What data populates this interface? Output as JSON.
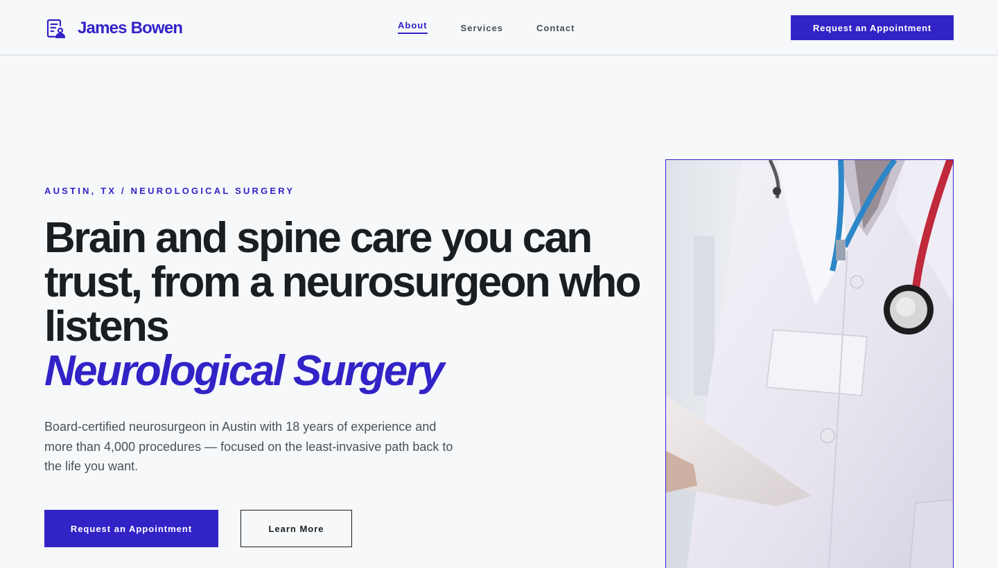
{
  "header": {
    "brand_name": "James Bowen",
    "nav": [
      {
        "label": "About",
        "active": true
      },
      {
        "label": "Services",
        "active": false
      },
      {
        "label": "Contact",
        "active": false
      }
    ],
    "cta_label": "Request an Appointment"
  },
  "hero": {
    "eyebrow": "AUSTIN, TX / NEUROLOGICAL SURGERY",
    "headline": "Brain and spine care you can trust, from a neurosurgeon who listens",
    "headline_accent": "Neurological Surgery",
    "lead": "Board-certified neurosurgeon in Austin with 18 years of experience and more than 4,000 procedures — focused on the least-invasive path back to the life you want.",
    "primary_button": "Request an Appointment",
    "secondary_button": "Learn More"
  },
  "colors": {
    "accent": "#3223c7",
    "text": "#1b1e20",
    "muted": "#4b5156",
    "background": "#f6f8fa"
  },
  "icons": {
    "brand": "medical-record-icon"
  }
}
